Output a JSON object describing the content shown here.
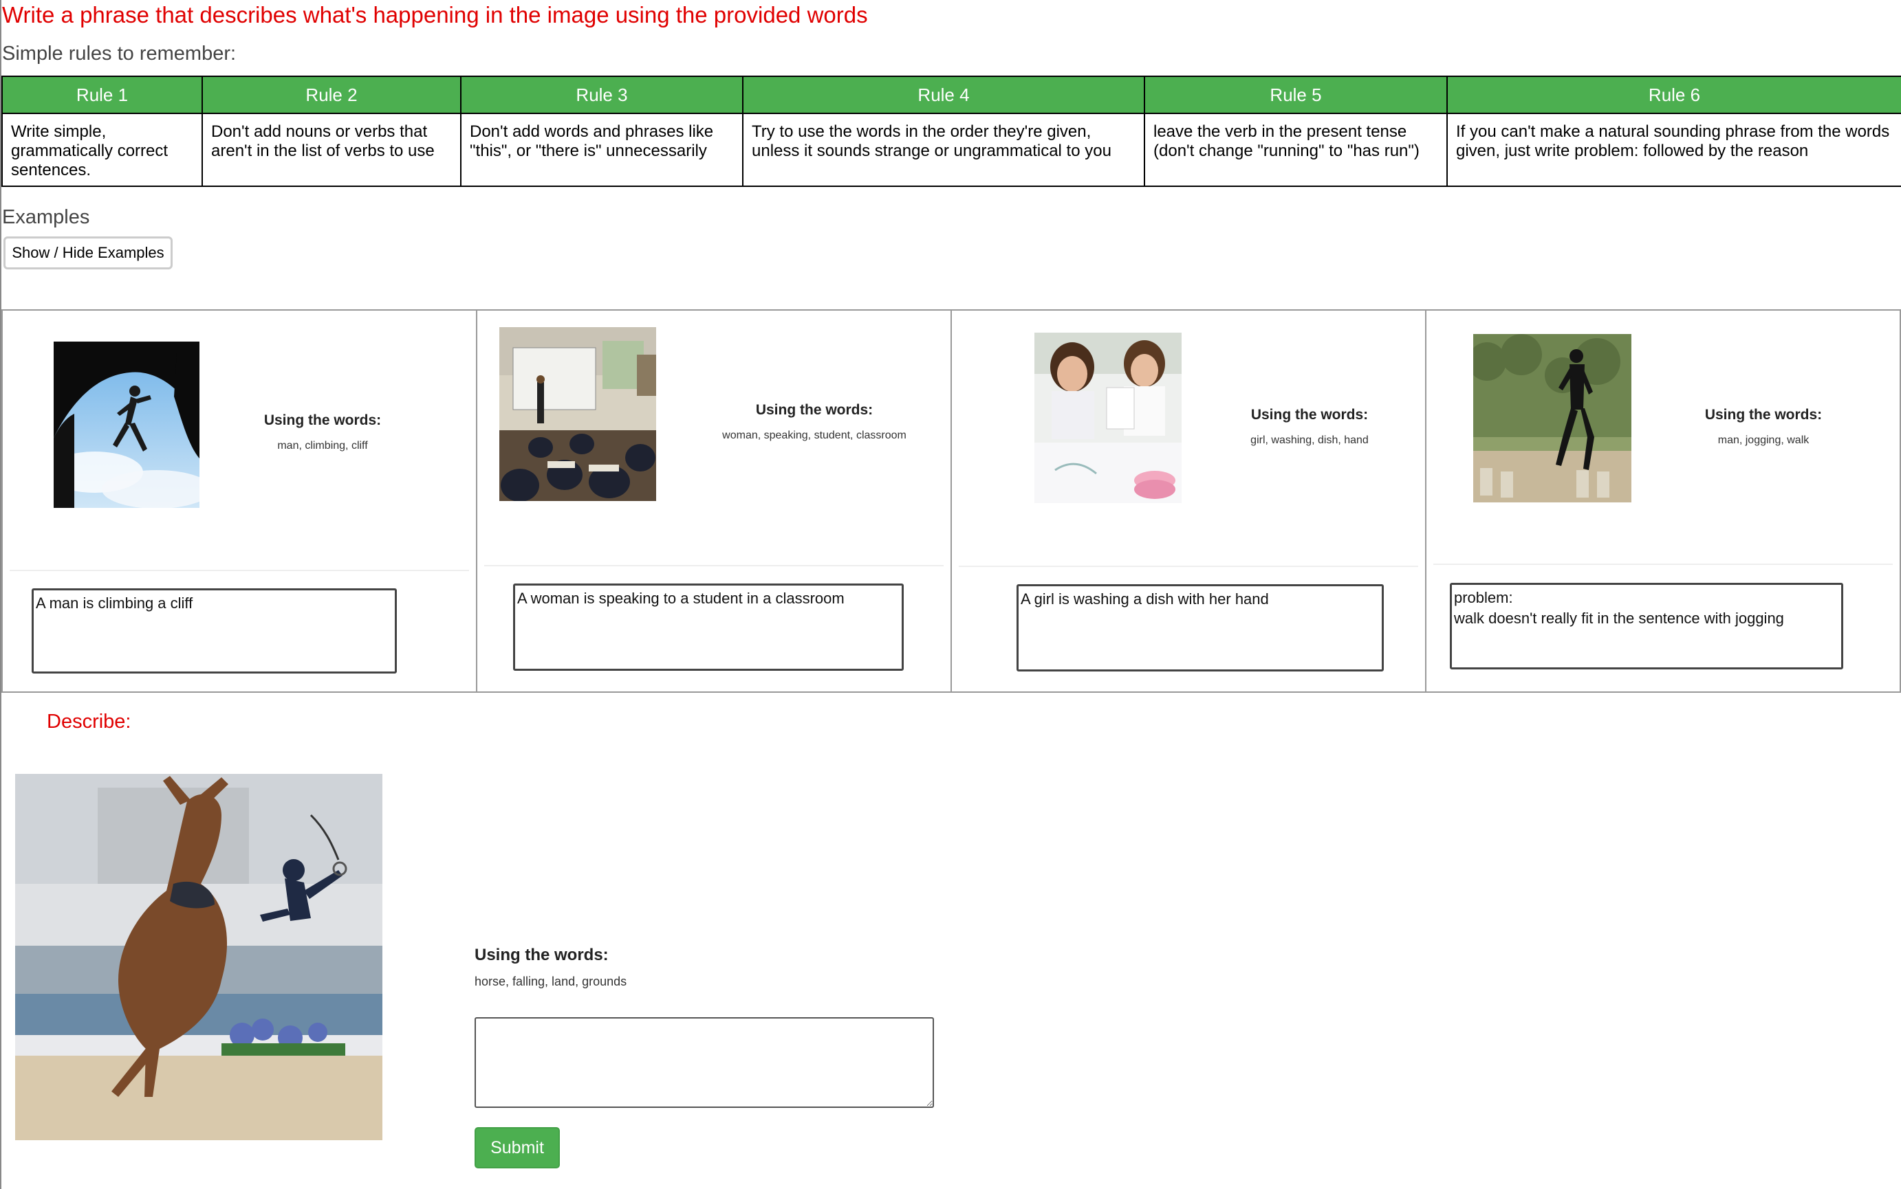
{
  "page": {
    "title": "Write a phrase that describes what's happening in the image using the provided words",
    "rules_heading": "Simple rules to remember:"
  },
  "rules": [
    {
      "header": "Rule 1",
      "text": "Write simple, grammatically correct sentences."
    },
    {
      "header": "Rule 2",
      "text": "Don't add nouns or verbs that aren't in the list of verbs to use"
    },
    {
      "header": "Rule 3",
      "text": "Don't add words and phrases like \"this\", or \"there is\" unnecessarily"
    },
    {
      "header": "Rule 4",
      "text": "Try to use the words in the order they're given, unless it sounds strange or ungrammatical to you"
    },
    {
      "header": "Rule 5",
      "text": "leave the verb in the present tense (don't change \"running\" to \"has run\")"
    },
    {
      "header": "Rule 6",
      "text": "If you can't make a natural sounding phrase from the words given, just write problem: followed by the reason"
    }
  ],
  "examples": {
    "heading": "Examples",
    "toggle_label": "Show / Hide Examples",
    "items": [
      {
        "words_title": "Using the words:",
        "words": "man, climbing, cliff",
        "answer": "A man is climbing a cliff",
        "image": "rock-climber-photo"
      },
      {
        "words_title": "Using the words:",
        "words": "woman, speaking, student, classroom",
        "answer": "A woman is speaking to a student in a classroom",
        "image": "classroom-photo"
      },
      {
        "words_title": "Using the words:",
        "words": "girl, washing, dish, hand",
        "answer": "A girl is washing a dish with her hand",
        "image": "girls-painting-dishes-photo"
      },
      {
        "words_title": "Using the words:",
        "words": "man, jogging, walk",
        "answer": "problem:\nwalk doesn't really fit in the sentence with jogging",
        "image": "man-jogging-photo"
      }
    ]
  },
  "task": {
    "describe_label": "Describe:",
    "image": "horse-falling-photo",
    "words_title": "Using the words:",
    "words": "horse, falling, land, grounds",
    "answer_value": "",
    "submit_label": "Submit"
  },
  "colors": {
    "title_red": "#e00000",
    "header_green": "#4caf50",
    "submit_green": "#4caf50"
  }
}
